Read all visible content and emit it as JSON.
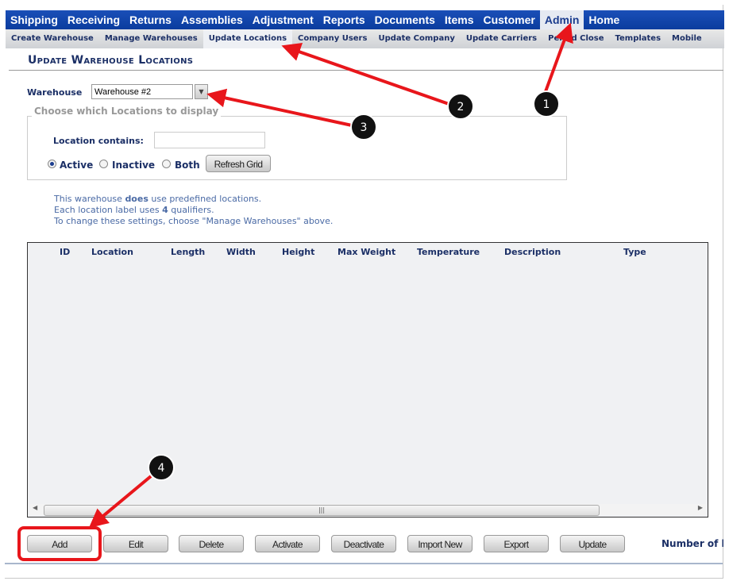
{
  "nav": {
    "items": [
      "Shipping",
      "Receiving",
      "Returns",
      "Assemblies",
      "Adjustment",
      "Reports",
      "Documents",
      "Items",
      "Customer",
      "Admin",
      "Home"
    ],
    "selected": "Admin"
  },
  "subnav": {
    "items": [
      "Create Warehouse",
      "Manage Warehouses",
      "Update Locations",
      "Company Users",
      "Update Company",
      "Update Carriers",
      "Period Close",
      "Templates",
      "Mobile"
    ],
    "selected": "Update Locations"
  },
  "page": {
    "title": "Update Warehouse Locations"
  },
  "warehouse": {
    "label": "Warehouse",
    "value": "Warehouse #2"
  },
  "filter": {
    "legend": "Choose which Locations to display",
    "location_label": "Location contains:",
    "location_value": "",
    "radios": [
      "Active",
      "Inactive",
      "Both"
    ],
    "selected": "Active",
    "refresh": "Refresh Grid"
  },
  "info": {
    "l1a": "This warehouse ",
    "l1b": "does",
    "l1c": " use predefined locations.",
    "l2a": "Each location label uses ",
    "l2b": "4",
    "l2c": " qualifiers.",
    "l3": "To change these settings, choose \"Manage Warehouses\" above."
  },
  "grid": {
    "columns": [
      "ID",
      "Location",
      "Length",
      "Width",
      "Height",
      "Max Weight",
      "Temperature",
      "Description",
      "Type"
    ],
    "rows": []
  },
  "buttons": [
    "Add",
    "Edit",
    "Delete",
    "Activate",
    "Deactivate",
    "Import New",
    "Export",
    "Update"
  ],
  "count_label": "Number of l",
  "annotations": [
    "1",
    "2",
    "3",
    "4"
  ],
  "colors": {
    "nav": "#0a3c9e",
    "annotation": "#e8161b"
  }
}
